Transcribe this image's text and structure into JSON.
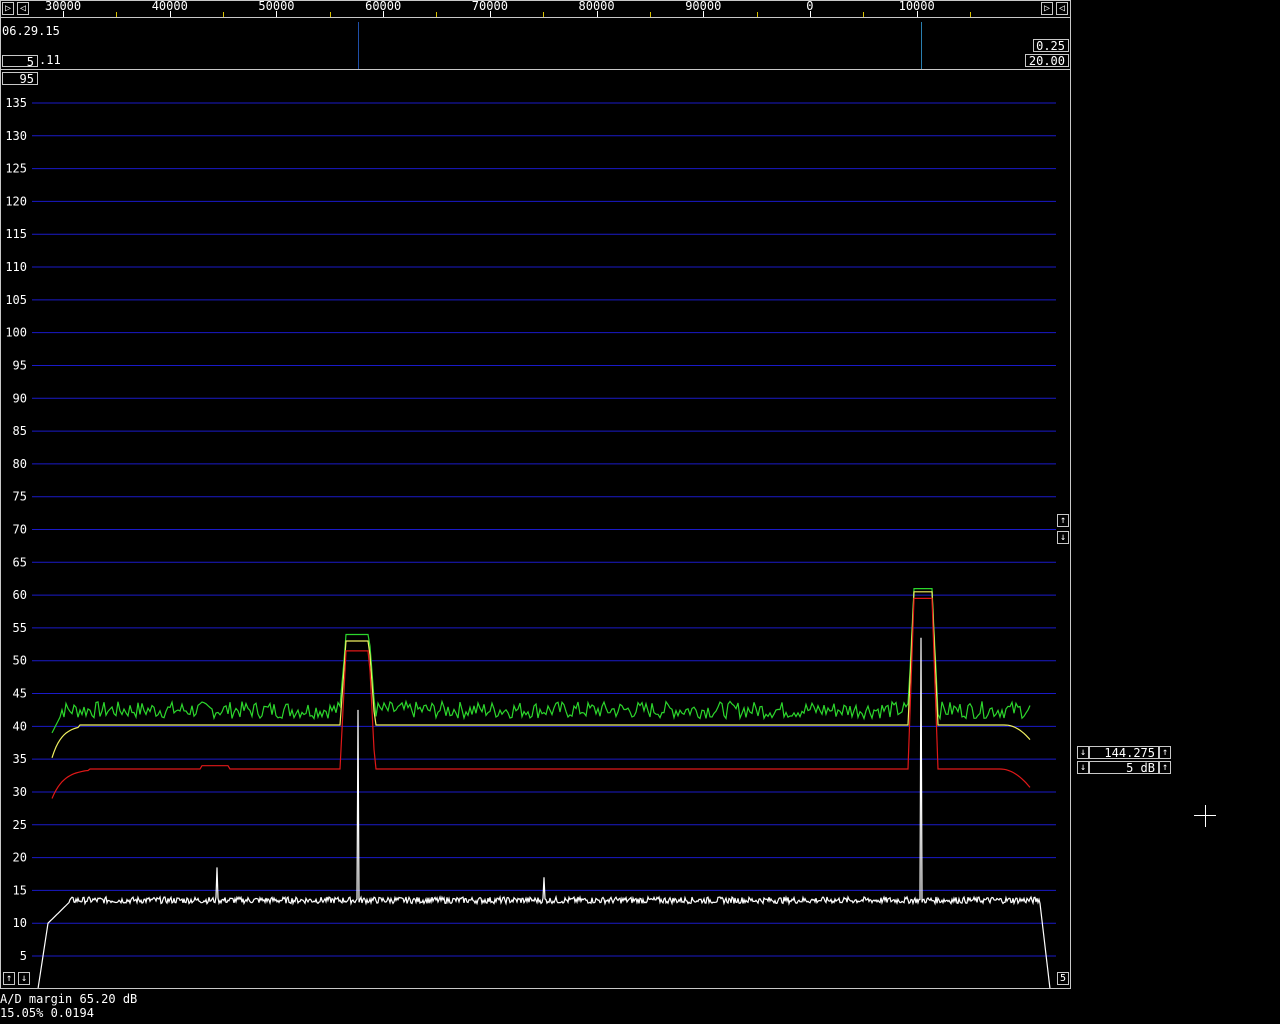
{
  "freq_scale": {
    "labels": [
      "30000",
      "40000",
      "50000",
      "60000",
      "70000",
      "80000",
      "90000",
      "0",
      "10000"
    ],
    "left_arrow": "▷",
    "left_arrow2": "◁",
    "right_arrow": "▷",
    "right_arrow2": "◁"
  },
  "waterfall_panel": {
    "date": "06.29.15",
    "left_value_box": "5",
    "left_value_suffix": ".11",
    "right_top_box": "0.25",
    "right_bottom_box": "20.00",
    "marker_color_1": "#1f4fa8",
    "marker_color_2": "#2a7fb0"
  },
  "spectrum": {
    "top_box": "95",
    "y_ticks": [
      "135",
      "130",
      "125",
      "120",
      "115",
      "110",
      "105",
      "100",
      "95",
      "90",
      "85",
      "80",
      "75",
      "70",
      "65",
      "60",
      "55",
      "50",
      "45",
      "40",
      "35",
      "30",
      "25",
      "20",
      "15",
      "10",
      "5"
    ],
    "grid_color": "#1a1ac8",
    "bottom_left_up": "↑",
    "bottom_left_down": "↓",
    "bottom_right_box": "5",
    "right_up": "↑",
    "right_down": "↓"
  },
  "status": {
    "line1": "A/D margin 65.20 dB",
    "line2": "15.05% 0.0194"
  },
  "side_controls": {
    "freq_value": "144.275",
    "db_value": "5 dB",
    "down_arrow": "↓",
    "up_arrow": "↑"
  },
  "colors": {
    "trace_green": "#2cd62c",
    "trace_yellow": "#f0f060",
    "trace_red": "#e01818",
    "trace_white": "#ffffff"
  }
}
